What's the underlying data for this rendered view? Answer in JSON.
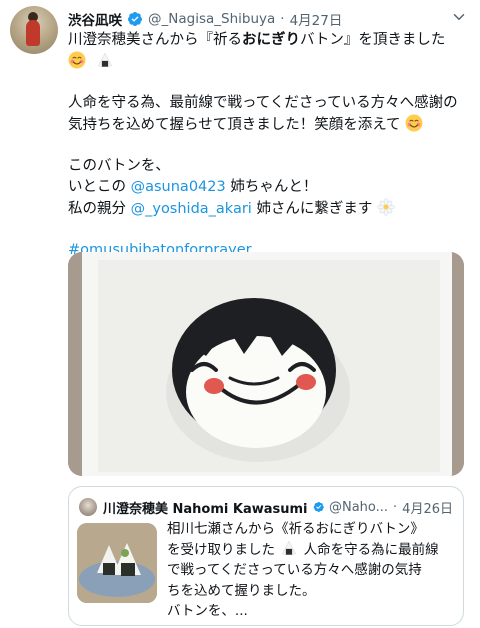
{
  "tweet": {
    "author_name": "渋谷凪咲",
    "handle": "@_Nagisa_Shibuya",
    "separator": "·",
    "date": "4月27日",
    "lines": {
      "l1": "川澄奈穂美さんから『祈る",
      "l1_bold": "おにぎり",
      "l1_tail": "バトン』を頂きました",
      "l3": "人命を守る為、最前線で戦ってくださっている方々へ感謝の",
      "l4": "気持ちを込めて握らせて頂きました！笑顔を添えて",
      "l6": "このバトンを、",
      "l7_prefix": "いとこの",
      "l7_mention": "@asuna0423",
      "l7_suffix": "姉ちゃんと！",
      "l8_prefix": "私の親分",
      "l8_mention": "@_yoshida_akari",
      "l8_suffix": "姉さんに繋ぎます",
      "hashtag": "#omusubibatonforprayer"
    }
  },
  "quoted": {
    "author_name": "川澄奈穂美 Nahomi Kawasumi",
    "handle": "@Naho...",
    "separator": "·",
    "date": "4月26日",
    "lines": {
      "q1": "相川七瀬さんから《祈るおにぎりバトン》",
      "q2a": "を受け取りました",
      "q2b": "人命を守る為に最前線",
      "q3": "で戦ってくださっている方々へ感謝の気持",
      "q4": "ちを込めて握りました。",
      "q5": "バトンを、..."
    }
  },
  "icons": {
    "verified": "verified-badge-icon",
    "caret": "chevron-down-icon",
    "smile": "smiling-face-emoji",
    "onigiri": "rice-ball-emoji",
    "flower": "daisy-emoji"
  },
  "colors": {
    "link": "#1b95e0",
    "secondary_text": "#536471",
    "verified": "#1d9bf0"
  }
}
